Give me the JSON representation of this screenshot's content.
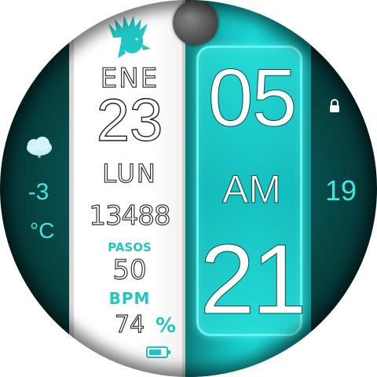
{
  "date": {
    "month": "ENE",
    "day": "23",
    "weekday": "LUN"
  },
  "steps": {
    "value": "13488",
    "label": "PASOS"
  },
  "heart_rate": {
    "value": "50",
    "label": "BPM"
  },
  "battery": {
    "value": "74",
    "unit": "%",
    "level": 0.74
  },
  "time": {
    "hour": "05",
    "ampm": "AM",
    "minute": "21"
  },
  "weather": {
    "temperature": "-3",
    "unit": "°C",
    "icon": "cloud-snow-icon"
  },
  "right_complication": {
    "value": "19",
    "icon": "lock-icon"
  },
  "icons": {
    "logo": "chief-head-logo",
    "moon": "moon-phase-icon"
  },
  "colors": {
    "accent": "#1fc6c4",
    "panel_teal": "#16c3c3",
    "text_teal": "#3ce8e4"
  }
}
